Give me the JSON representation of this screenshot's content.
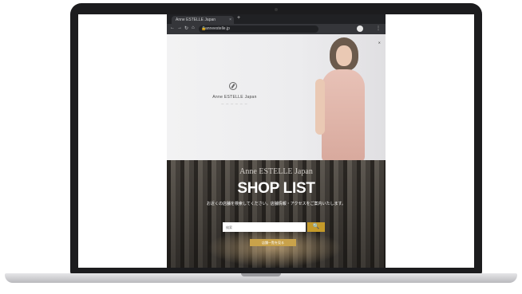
{
  "browser": {
    "tab_title": "Anne ESTELLE Japan",
    "tab_close": "×",
    "new_tab": "+",
    "nav": {
      "back": "←",
      "forward": "→",
      "reload": "↻",
      "home": "⌂"
    },
    "address": "anneestelle.jp",
    "lock_icon": "🔒",
    "menu_icon": "⋮"
  },
  "hero": {
    "brand_name": "Anne ESTELLE Japan",
    "brand_sub": "— — — — — —",
    "close_label": "✕"
  },
  "shop": {
    "brand_name": "Anne ESTELLE Japan",
    "title": "SHOP LIST",
    "description": "お近くの店舗を検索してください。店舗情報・アクセスをご案内いたします。",
    "search_placeholder": "検索",
    "search_button_icon": "🔍",
    "more_button": "店舗一覧を見る"
  },
  "colors": {
    "accent": "#c49a2a",
    "browser_chrome": "#202124",
    "laptop_frame": "#1c1c1e"
  }
}
